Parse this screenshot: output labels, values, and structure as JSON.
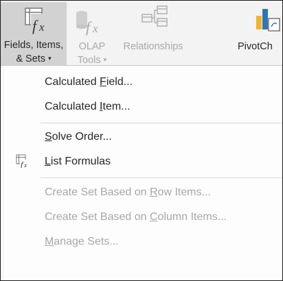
{
  "ribbon": {
    "fields_items_sets": {
      "line1": "Fields, Items,",
      "line2": "& Sets",
      "icon": "fields-items-sets-icon"
    },
    "olap_tools": {
      "line1": "OLAP",
      "line2": "Tools",
      "icon": "olap-tools-icon"
    },
    "relationships": {
      "line1": "Relationships",
      "icon": "relationships-icon"
    },
    "pivotchart": {
      "line1": "PivotCh",
      "icon": "pivotchart-icon"
    }
  },
  "menu": {
    "items": [
      {
        "pre": "Calculated ",
        "key": "F",
        "post": "ield...",
        "enabled": true
      },
      {
        "pre": "Calculated ",
        "key": "I",
        "post": "tem...",
        "enabled": true
      },
      {
        "pre": "",
        "key": "S",
        "post": "olve Order...",
        "enabled": true
      },
      {
        "pre": "",
        "key": "L",
        "post": "ist Formulas",
        "enabled": true,
        "icon": "list-formulas-icon"
      },
      {
        "pre": "Create Set Based on ",
        "key": "R",
        "post": "ow Items...",
        "enabled": false
      },
      {
        "pre": "Create Set Based on ",
        "key": "C",
        "post": "olumn Items...",
        "enabled": false
      },
      {
        "pre": "",
        "key": "M",
        "post": "anage Sets...",
        "enabled": false
      }
    ]
  },
  "colors": {
    "ribbon_bg": "#f3f3f3",
    "selected_bg": "#d2d2d2",
    "disabled_text": "#a8a8a8",
    "pivot_accent": "#f0b330"
  }
}
